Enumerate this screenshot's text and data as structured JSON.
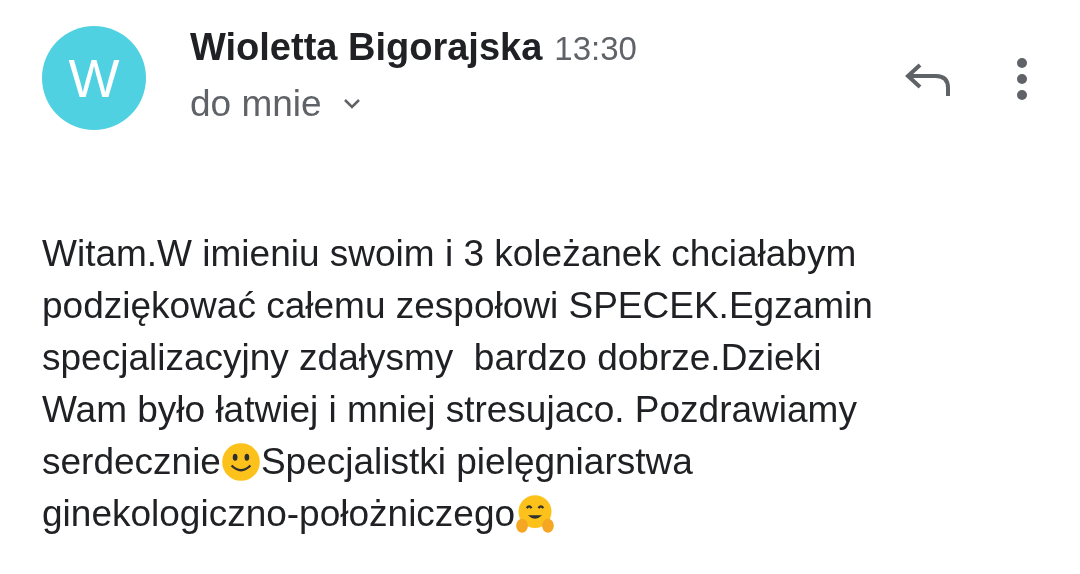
{
  "sender": {
    "initial": "W",
    "name": "Wioletta Bigorajska",
    "time": "13:30",
    "recipient": "do mnie"
  },
  "body": [
    [
      {
        "kind": "text",
        "text": "Witam.W imieniu swoim i 3 koleżanek chciałabym"
      }
    ],
    [
      {
        "kind": "text",
        "text": "podziękować całemu zespołowi SPECEK.Egzamin"
      }
    ],
    [
      {
        "kind": "text",
        "text": "specjalizacyjny zdałysmy  bardzo dobrze.Dzieki"
      }
    ],
    [
      {
        "kind": "text",
        "text": "Wam było łatwiej i mniej stresujaco. Pozdrawiamy"
      }
    ],
    [
      {
        "kind": "text",
        "text": "serdecznie"
      },
      {
        "kind": "smiley"
      },
      {
        "kind": "text",
        "text": "Specjalistki pielęgniarstwa"
      }
    ],
    [
      {
        "kind": "text",
        "text": "ginekologiczno-położniczego"
      },
      {
        "kind": "hug"
      }
    ]
  ]
}
